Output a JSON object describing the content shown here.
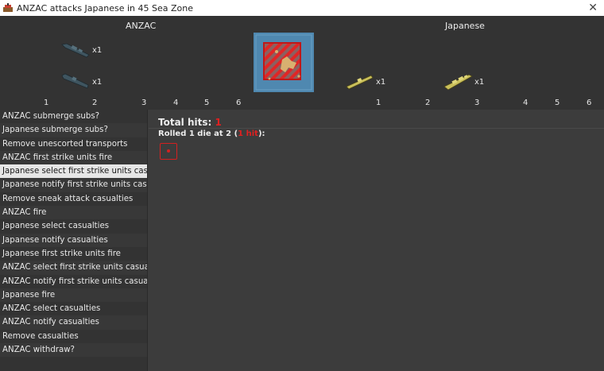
{
  "window": {
    "title": "ANZAC attacks Japanese in 45 Sea Zone",
    "close_glyph": "✕"
  },
  "attacker": {
    "name": "ANZAC",
    "units": [
      {
        "type": "destroyer",
        "count": "x1"
      },
      {
        "type": "submarine",
        "count": "x1"
      }
    ],
    "columns": [
      "1",
      "2",
      "3",
      "4",
      "5",
      "6"
    ]
  },
  "defender": {
    "name": "Japanese",
    "units": [
      {
        "type": "submarine",
        "count": "x1"
      },
      {
        "type": "destroyer",
        "count": "x1"
      }
    ],
    "columns": [
      "1",
      "2",
      "3",
      "4",
      "5",
      "6"
    ]
  },
  "steps": [
    "ANZAC submerge subs?",
    "Japanese submerge subs?",
    "Remove unescorted transports",
    "ANZAC first strike units fire",
    "Japanese select first strike units casualties",
    "Japanese notify first strike units casualties",
    "Remove sneak attack casualties",
    "ANZAC fire",
    "Japanese select casualties",
    "Japanese notify casualties",
    "Japanese first strike units fire",
    "ANZAC select first strike units casualties",
    "ANZAC notify first strike units casualties",
    "Japanese fire",
    "ANZAC select casualties",
    "ANZAC notify casualties",
    "Remove casualties",
    "ANZAC withdraw?"
  ],
  "selected_step_index": 4,
  "results": {
    "total_label": "Total hits:",
    "total_value": "1",
    "rolled_prefix": "Rolled 1 die at 2 (",
    "rolled_hits": "1 hit",
    "rolled_suffix": "):",
    "die_value": 1
  },
  "colors": {
    "hit": "#e02020",
    "allied_unit": "#3f5560",
    "japanese_unit": "#c9bf5a"
  }
}
